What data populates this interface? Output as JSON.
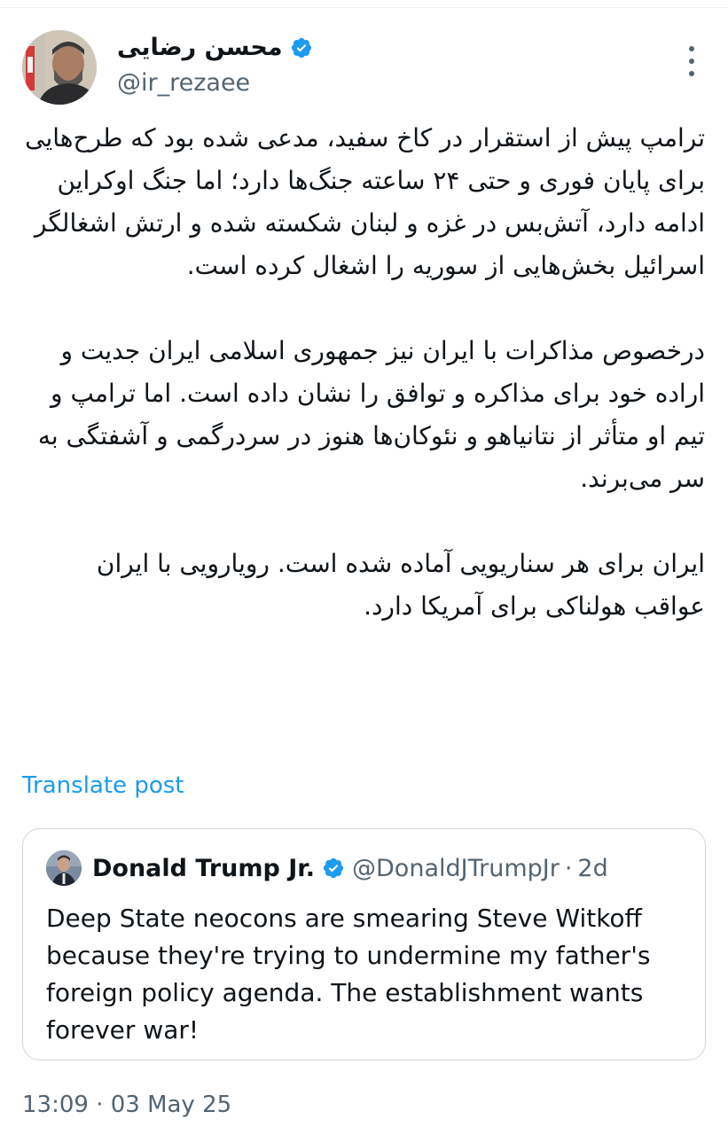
{
  "author": {
    "display_name": "محسن رضایی",
    "handle": "@ir_rezaee",
    "verified": true
  },
  "post": {
    "paragraphs": [
      "ترامپ پیش از استقرار در کاخ سفید، مدعی شده بود که طرح‌هایی برای پایان فوری و حتی ۲۴ ساعته جنگ‌ها دارد؛ اما جنگ اوکراین ادامه دارد، آتش‌بس در غزه و لبنان شکسته شده و ارتش اشغالگر اسرائیل بخش‌هایی از سوریه را اشغال کرده است.",
      "درخصوص مذاکرات با ایران نیز جمهوری اسلامی ایران جدیت و اراده خود برای مذاکره و توافق را نشان داده است. اما ترامپ و تیم او متأثر از نتانیاهو و نئوکان‌ها هنوز در سردرگمی و آشفتگی به سر می‌برند.",
      "ایران برای هر سناریویی آماده شده است. رویارویی با ایران عواقب هولناکی برای آمریکا دارد."
    ],
    "translate_label": "Translate post",
    "timestamp": "13:09 · 03 May 25"
  },
  "quote": {
    "display_name": "Donald Trump Jr.",
    "handle": "@DonaldJTrumpJr",
    "separator": "·",
    "time": "2d",
    "verified": true,
    "text": "Deep State neocons are smearing Steve Witkoff because they're trying to undermine my father's foreign policy agenda. The establishment wants forever war!"
  },
  "colors": {
    "verified_blue": "#1d9bf0",
    "link_blue": "#1d9bf0",
    "secondary_text": "#536471",
    "border": "#cfd9de"
  },
  "icons": [
    "more-options-icon",
    "verified-badge-icon"
  ]
}
